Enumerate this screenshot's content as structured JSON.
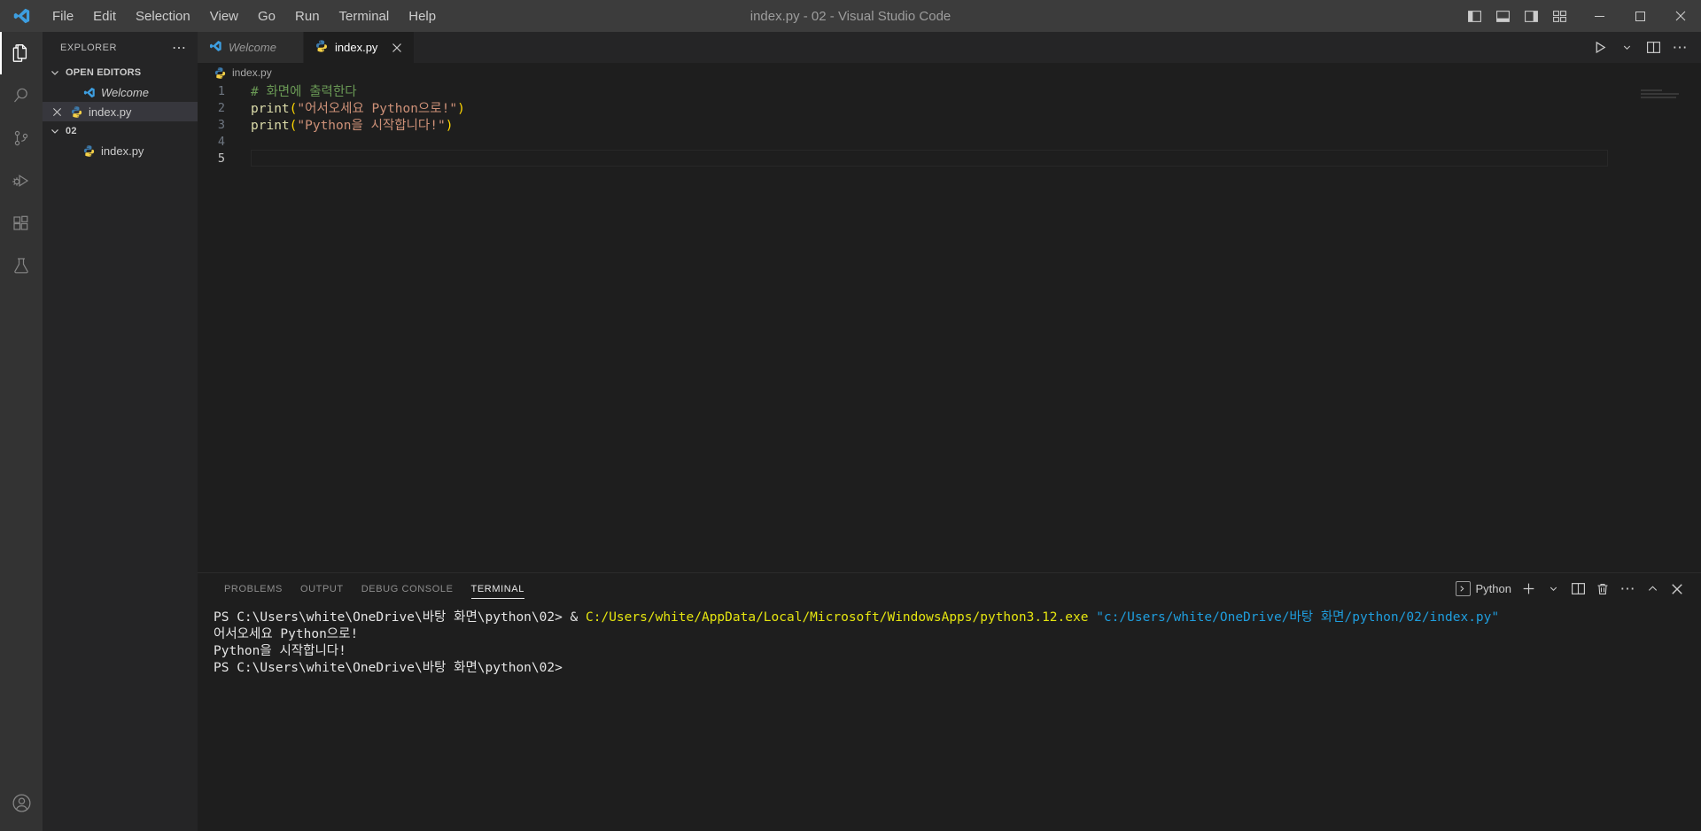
{
  "window": {
    "title": "index.py - 02 - Visual Studio Code",
    "logo_icon": "vscode-logo-icon",
    "controls": {
      "minimize_icon": "minimize-icon",
      "maximize_icon": "maximize-icon",
      "close_icon": "close-icon"
    },
    "layout_icons": [
      "toggle-primary-sidebar-icon",
      "toggle-panel-icon",
      "toggle-secondary-sidebar-icon",
      "customize-layout-icon"
    ]
  },
  "menubar": {
    "items": [
      {
        "label": "File"
      },
      {
        "label": "Edit"
      },
      {
        "label": "Selection"
      },
      {
        "label": "View"
      },
      {
        "label": "Go"
      },
      {
        "label": "Run"
      },
      {
        "label": "Terminal"
      },
      {
        "label": "Help"
      }
    ]
  },
  "activitybar": {
    "items": [
      {
        "name": "explorer",
        "icon": "files-icon",
        "active": true
      },
      {
        "name": "search",
        "icon": "search-icon",
        "active": false
      },
      {
        "name": "source-control",
        "icon": "source-control-icon",
        "active": false
      },
      {
        "name": "run-and-debug",
        "icon": "run-and-debug-icon",
        "active": false
      },
      {
        "name": "extensions",
        "icon": "extensions-icon",
        "active": false
      },
      {
        "name": "testing",
        "icon": "beaker-icon",
        "active": false
      }
    ],
    "bottom": [
      {
        "name": "accounts",
        "icon": "account-icon"
      }
    ]
  },
  "sidebar": {
    "title": "EXPLORER",
    "more_actions_icon": "ellipsis-icon",
    "sections": [
      {
        "label": "OPEN EDITORS",
        "expanded": true,
        "items": [
          {
            "label": "Welcome",
            "icon": "vscode-logo-icon",
            "preview": true,
            "selected": false,
            "has_close": false
          },
          {
            "label": "index.py",
            "icon": "python-icon",
            "preview": false,
            "selected": true,
            "has_close": true
          }
        ]
      },
      {
        "label": "02",
        "expanded": true,
        "items": [
          {
            "label": "index.py",
            "icon": "python-icon",
            "preview": false,
            "selected": false,
            "has_close": false
          }
        ]
      }
    ]
  },
  "editor": {
    "tabs": [
      {
        "label": "Welcome",
        "icon": "vscode-logo-icon",
        "active": false,
        "preview": true,
        "has_close": false
      },
      {
        "label": "index.py",
        "icon": "python-icon",
        "active": true,
        "preview": false,
        "has_close": true,
        "close_icon": "close-icon"
      }
    ],
    "tab_actions": [
      {
        "name": "run-python-file",
        "icon": "play-icon"
      },
      {
        "name": "run-options",
        "icon": "chevron-down-icon"
      },
      {
        "name": "split-editor",
        "icon": "split-editor-icon"
      },
      {
        "name": "more-actions",
        "icon": "ellipsis-icon"
      }
    ],
    "breadcrumb": {
      "icon": "python-icon",
      "label": "index.py"
    },
    "lines": [
      {
        "number": "1",
        "tokens": [
          {
            "t": "# 화면에 출력한다",
            "c": "tok-comment"
          }
        ]
      },
      {
        "number": "2",
        "tokens": [
          {
            "t": "print",
            "c": "tok-func"
          },
          {
            "t": "(",
            "c": "tok-paren"
          },
          {
            "t": "\"어서오세요 Python으로!\"",
            "c": "tok-string"
          },
          {
            "t": ")",
            "c": "tok-paren"
          }
        ]
      },
      {
        "number": "3",
        "tokens": [
          {
            "t": "print",
            "c": "tok-func"
          },
          {
            "t": "(",
            "c": "tok-paren"
          },
          {
            "t": "\"Python을 시작합니다!\"",
            "c": "tok-string"
          },
          {
            "t": ")",
            "c": "tok-paren"
          }
        ]
      },
      {
        "number": "4",
        "tokens": []
      },
      {
        "number": "5",
        "tokens": [],
        "current": true
      }
    ]
  },
  "panel": {
    "tabs": [
      {
        "label": "PROBLEMS",
        "active": false
      },
      {
        "label": "OUTPUT",
        "active": false
      },
      {
        "label": "DEBUG CONSOLE",
        "active": false
      },
      {
        "label": "TERMINAL",
        "active": true
      }
    ],
    "actions": {
      "terminal_name": "Python",
      "terminal_icon": "terminal-chevron-icon",
      "new_terminal_icon": "plus-icon",
      "new_terminal_options_icon": "chevron-down-icon",
      "split_terminal_icon": "split-icon",
      "kill_terminal_icon": "trash-icon",
      "more_icon": "ellipsis-icon",
      "maximize_panel_icon": "chevron-up-icon",
      "close_panel_icon": "close-icon"
    },
    "terminal_lines": [
      [
        {
          "t": "PS C:\\Users\\white\\OneDrive\\바탕 화면\\python\\02> & ",
          "c": "t-white"
        },
        {
          "t": "C:/Users/white/AppData/Local/Microsoft/WindowsApps/python3.12.exe ",
          "c": "t-yellow"
        },
        {
          "t": "\"c:/Users/white/OneDrive/바탕 화면/python/02/index.py\"",
          "c": "t-cyan"
        }
      ],
      [
        {
          "t": "어서오세요 Python으로!",
          "c": "t-white"
        }
      ],
      [
        {
          "t": "Python을 시작합니다!",
          "c": "t-white"
        }
      ],
      [
        {
          "t": "PS C:\\Users\\white\\OneDrive\\바탕 화면\\python\\02>",
          "c": "t-white"
        }
      ]
    ]
  },
  "colors": {
    "titlebar_bg": "#3c3c3c",
    "activitybar_bg": "#333333",
    "sidebar_bg": "#252526",
    "editor_bg": "#1e1e1e",
    "accent": "#007acc",
    "comment": "#6A9955",
    "string": "#CE9178",
    "function": "#DCDCAA",
    "terminal_yellow": "#e5e510",
    "terminal_cyan": "#1f9ede"
  }
}
